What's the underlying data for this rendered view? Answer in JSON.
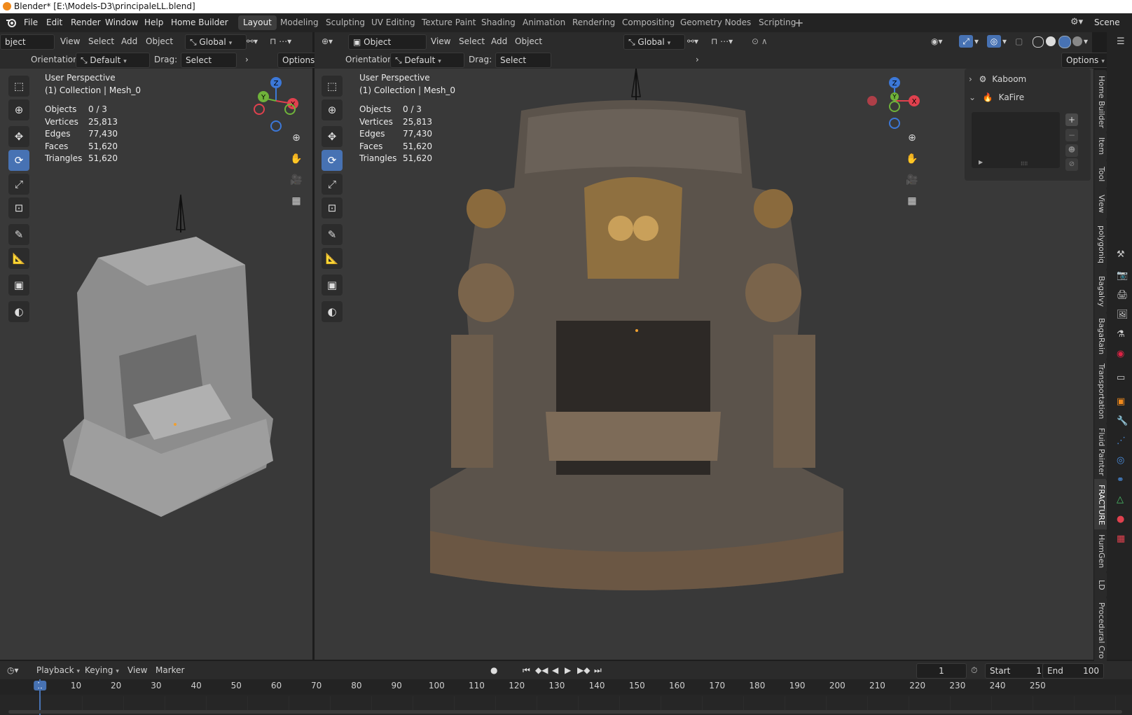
{
  "window": {
    "title": "Blender* [E:\\Models-D3\\principaleLL.blend]"
  },
  "menu": {
    "items": [
      "File",
      "Edit",
      "Render",
      "Window",
      "Help",
      "Home Builder"
    ],
    "workspaces": [
      "Layout",
      "Modeling",
      "Sculpting",
      "UV Editing",
      "Texture Paint",
      "Shading",
      "Animation",
      "Rendering",
      "Compositing",
      "Geometry Nodes",
      "Scripting"
    ],
    "active_workspace": "Layout",
    "scene": "Scene"
  },
  "left_viewport": {
    "mode": "bject Mode",
    "menus": [
      "View",
      "Select",
      "Add",
      "Object"
    ],
    "transform": "Global",
    "orientation_label": "Orientation:",
    "orientation_value": "Default",
    "drag_label": "Drag:",
    "drag_value": "Select Box",
    "options_label": "Options",
    "overlay": {
      "perspective": "User Perspective",
      "collection": "(1) Collection | Mesh_0",
      "stats": [
        {
          "label": "Objects",
          "value": "0 / 3"
        },
        {
          "label": "Vertices",
          "value": "25,813"
        },
        {
          "label": "Edges",
          "value": "77,430"
        },
        {
          "label": "Faces",
          "value": "51,620"
        },
        {
          "label": "Triangles",
          "value": "51,620"
        }
      ]
    }
  },
  "right_viewport": {
    "mode": "Object Mode",
    "menus": [
      "View",
      "Select",
      "Add",
      "Object"
    ],
    "transform": "Global",
    "orientation_label": "Orientation:",
    "orientation_value": "Default",
    "drag_label": "Drag:",
    "drag_value": "Select Box",
    "options_label": "Options",
    "overlay": {
      "perspective": "User Perspective",
      "collection": "(1) Collection | Mesh_0",
      "stats": [
        {
          "label": "Objects",
          "value": "0 / 3"
        },
        {
          "label": "Vertices",
          "value": "25,813"
        },
        {
          "label": "Edges",
          "value": "77,430"
        },
        {
          "label": "Faces",
          "value": "51,620"
        },
        {
          "label": "Triangles",
          "value": "51,620"
        }
      ]
    }
  },
  "gizmo": {
    "x": "X",
    "y": "Y",
    "z": "Z"
  },
  "n_panel": {
    "items": [
      "Kaboom",
      "KaFire"
    ],
    "tabs": [
      "Home Builder",
      "Item",
      "Tool",
      "View",
      "polygoniq",
      "Bagalvy",
      "BagaRain",
      "Transportation",
      "Fluid Painter",
      "FRACTURE",
      "HumGen",
      "LD",
      "Procedural Cro"
    ]
  },
  "timeline": {
    "menus": [
      "Playback",
      "Keying",
      "View",
      "Marker"
    ],
    "current_frame": "1",
    "start_label": "Start",
    "start_value": "1",
    "end_label": "End",
    "end_value": "100",
    "ruler": [
      "1",
      "10",
      "20",
      "30",
      "40",
      "50",
      "60",
      "70",
      "80",
      "90",
      "100",
      "110",
      "120",
      "130",
      "140",
      "150",
      "160",
      "170",
      "180",
      "190",
      "200",
      "210",
      "220",
      "230",
      "240",
      "250"
    ]
  },
  "colors": {
    "accent": "#4772b3",
    "axis_x": "#e0414e",
    "axis_y": "#6fb33a",
    "axis_z": "#3c78d8",
    "header": "#2b2b2b",
    "viewport": "#393939"
  }
}
